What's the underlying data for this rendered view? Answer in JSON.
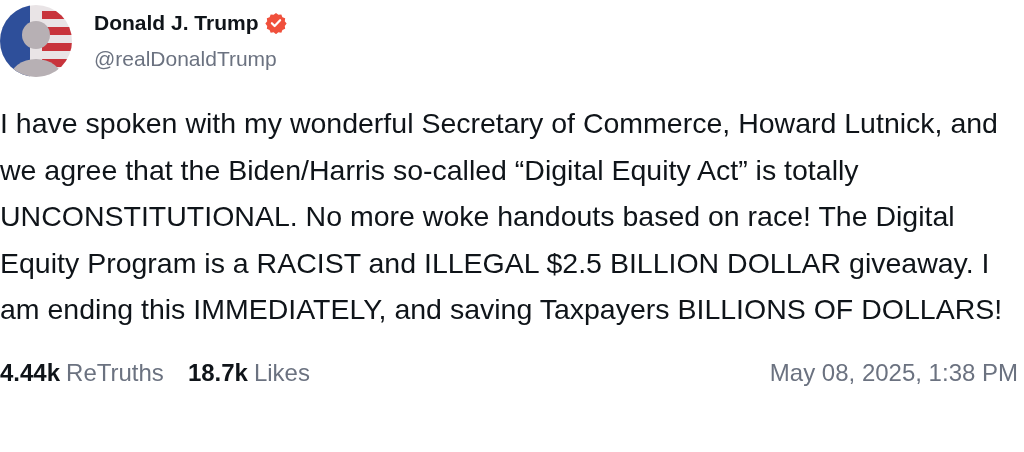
{
  "author": {
    "name": "Donald J. Trump",
    "handle": "@realDonaldTrump",
    "verified": true
  },
  "post": {
    "text": "I have spoken with my wonderful Secretary of Commerce, Howard Lutnick, and we agree that the Biden/Harris so-called “Digital Equity Act” is totally UNCONSTITUTIONAL. No more woke handouts based on race! The Digital Equity Program is a RACIST and ILLEGAL $2.5 BILLION DOLLAR giveaway. I am ending this IMMEDIATELY, and saving Taxpayers BILLIONS OF DOLLARS!"
  },
  "stats": [
    {
      "count": "4.44k",
      "label": "ReTruths"
    },
    {
      "count": "18.7k",
      "label": "Likes"
    }
  ],
  "timestamp": "May 08, 2025, 1:38 PM"
}
